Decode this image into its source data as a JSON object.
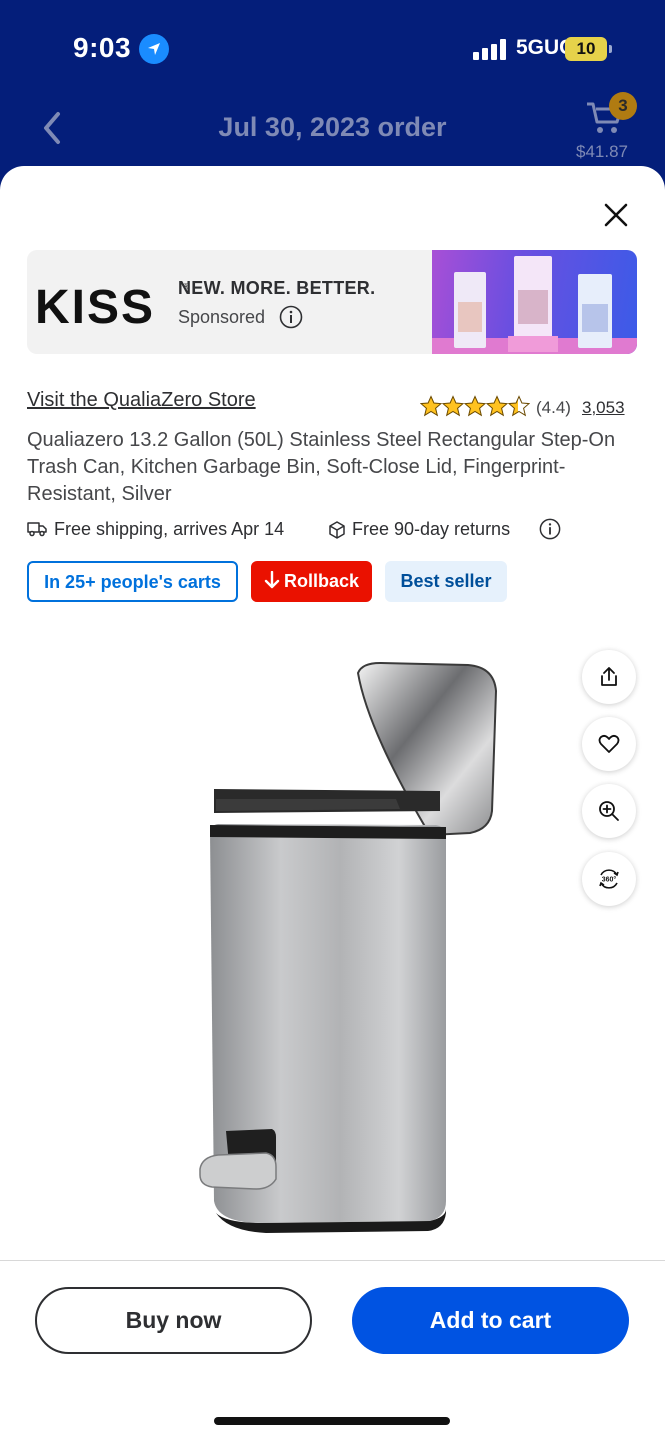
{
  "status_bar": {
    "time": "9:03",
    "network": "5GUC",
    "battery": "10",
    "colors": {
      "location": "#1a8cff",
      "battery": "#e6d24a"
    }
  },
  "nav": {
    "title": "Jul 30, 2023 order",
    "cart_count": "3",
    "cart_total": "$41.87",
    "icons": {
      "back": "chevron-left-icon",
      "cart": "cart-icon"
    }
  },
  "ad": {
    "brand": "KISS",
    "headline": "NEW. MORE. BETTER.",
    "sponsored_label": "Sponsored"
  },
  "product": {
    "store_link": "Visit the QualiaZero Store",
    "rating_value": "(4.4)",
    "rating": 4.4,
    "rating_count": "3,053",
    "title": "Qualiazero 13.2 Gallon (50L) Stainless Steel Rectangular Step-On Trash Can, Kitchen Garbage Bin, Soft-Close Lid, Fingerprint-Resistant, Silver",
    "shipping": "Free shipping, arrives Apr 14",
    "returns": "Free 90-day returns",
    "badges": {
      "carts": "In 25+ people's carts",
      "rollback": "Rollback",
      "best_seller": "Best seller"
    }
  },
  "side_actions": [
    "share-icon",
    "heart-icon",
    "zoom-in-icon",
    "360-view-icon"
  ],
  "actions": {
    "buy_now": "Buy now",
    "add_to_cart": "Add to cart"
  },
  "colors": {
    "header_bg": "#041e7a",
    "primary_blue": "#0053e2",
    "rollback_red": "#ea1100",
    "star_gold": "#ffc220"
  }
}
